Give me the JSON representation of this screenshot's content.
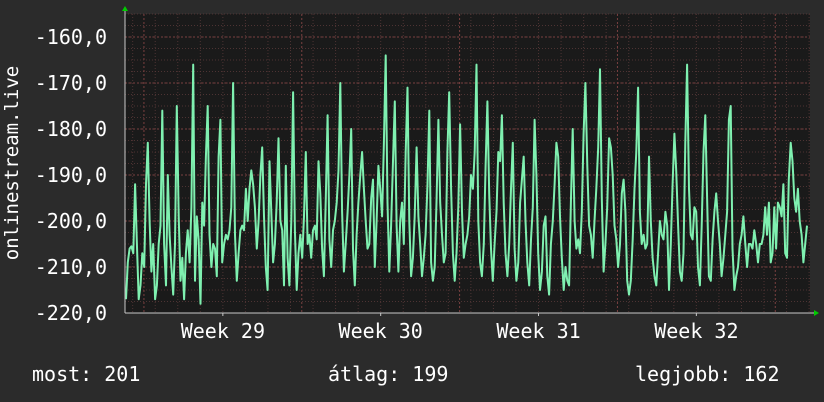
{
  "chart_data": {
    "type": "line",
    "ylabel": "onlinestream.live",
    "ylim": [
      -220,
      -155
    ],
    "y_ticks": [
      {
        "value": -160,
        "label": "-160,0"
      },
      {
        "value": -170,
        "label": "-170,0"
      },
      {
        "value": -180,
        "label": "-180,0"
      },
      {
        "value": -190,
        "label": "-190,0"
      },
      {
        "value": -200,
        "label": "-200,0"
      },
      {
        "value": -210,
        "label": "-210,0"
      },
      {
        "value": -220,
        "label": "-220,0"
      }
    ],
    "x_ticks": [
      {
        "value": 29,
        "label": "Week 29"
      },
      {
        "value": 30,
        "label": "Week 30"
      },
      {
        "value": 31,
        "label": "Week 31"
      },
      {
        "value": 32,
        "label": "Week 32"
      }
    ],
    "xlim": [
      28.38,
      32.72
    ],
    "grid": true,
    "colors": {
      "background": "#2b2b2b",
      "plot_area": "#1a1a1a",
      "grid": "#5a3a3a",
      "axis": "#c8c8c8",
      "line": "#7ff0b0",
      "arrow": "#00cc00",
      "text": "#ffffff"
    },
    "series": [
      {
        "values": [
          -217,
          -209,
          -206,
          -205.5,
          -207,
          -192,
          -205,
          -217,
          -214,
          -207,
          -210,
          -192,
          -183,
          -200,
          -211,
          -205,
          -217,
          -214,
          -205,
          -201,
          -176,
          -205,
          -214,
          -190,
          -203,
          -210,
          -216,
          -205,
          -175,
          -199,
          -213,
          -208,
          -217,
          -207,
          -202,
          -209,
          -197,
          -166,
          -213,
          -199,
          -204,
          -218,
          -196,
          -201,
          -186,
          -175,
          -203,
          -210,
          -205,
          -206,
          -212,
          -186,
          -178,
          -209,
          -205,
          -203,
          -204,
          -202,
          -197,
          -170,
          -203,
          -213,
          -207,
          -202,
          -201,
          -202,
          -193,
          -200,
          -193,
          -189,
          -192,
          -197,
          -206,
          -200,
          -190,
          -184,
          -199,
          -210,
          -215,
          -187,
          -198,
          -209,
          -205,
          -196,
          -182,
          -200,
          -202,
          -214,
          -188,
          -208,
          -214,
          -200,
          -172,
          -202,
          -215,
          -207,
          -203,
          -208,
          -199,
          -185,
          -205,
          -203,
          -208,
          -202,
          -201,
          -204,
          -187,
          -194,
          -206,
          -212,
          -195,
          -177,
          -204,
          -210,
          -202,
          -200,
          -196,
          -189,
          -170,
          -198,
          -211,
          -205,
          -198,
          -190,
          -180,
          -206,
          -214,
          -203,
          -196,
          -190,
          -185,
          -193,
          -200,
          -206,
          -205,
          -195,
          -191,
          -210,
          -200,
          -188,
          -193,
          -199,
          -183,
          -164,
          -196,
          -211,
          -201,
          -187,
          -174,
          -201,
          -211,
          -200,
          -196,
          -205,
          -185,
          -171,
          -200,
          -212,
          -208,
          -199,
          -184,
          -199,
          -205,
          -212,
          -208,
          -203,
          -192,
          -176,
          -209,
          -213,
          -210,
          -196,
          -178,
          -196,
          -203,
          -209,
          -207,
          -185,
          -172,
          -193,
          -207,
          -213,
          -207,
          -197,
          -179,
          -198,
          -208,
          -205,
          -203,
          -199,
          -190,
          -193,
          -185,
          -166,
          -200,
          -209,
          -212,
          -205,
          -188,
          -174,
          -194,
          -206,
          -213,
          -205,
          -198,
          -185,
          -187,
          -177,
          -196,
          -207,
          -212,
          -205,
          -193,
          -183,
          -206,
          -213,
          -209,
          -196,
          -191,
          -186,
          -200,
          -209,
          -214,
          -204,
          -197,
          -178,
          -190,
          -207,
          -215,
          -211,
          -201,
          -199,
          -212,
          -216,
          -205,
          -200,
          -192,
          -183,
          -186,
          -199,
          -208,
          -215,
          -210,
          -213,
          -214,
          -196,
          -180,
          -200,
          -206,
          -204,
          -207,
          -198,
          -181,
          -170,
          -188,
          -201,
          -203,
          -208,
          -200,
          -193,
          -184,
          -167,
          -195,
          -211,
          -205,
          -197,
          -182,
          -184,
          -190,
          -201,
          -204,
          -210,
          -205,
          -194,
          -191,
          -198,
          -213,
          -216,
          -213,
          -204,
          -193,
          -185,
          -171,
          -198,
          -205,
          -203,
          -206,
          -205,
          -186,
          -200,
          -208,
          -212,
          -214,
          -207,
          -200,
          -203,
          -204,
          -198,
          -201,
          -215,
          -205,
          -192,
          -181,
          -189,
          -201,
          -211,
          -213,
          -207,
          -183,
          -166,
          -193,
          -203,
          -204,
          -197,
          -198,
          -210,
          -214,
          -201,
          -185,
          -177,
          -195,
          -212,
          -213,
          -204,
          -198,
          -194,
          -200,
          -205,
          -212,
          -208,
          -203,
          -198,
          -178,
          -175,
          -206,
          -215,
          -212,
          -210,
          -205,
          -203,
          -199,
          -205,
          -210,
          -205,
          -205,
          -206,
          -202,
          -205,
          -209,
          -205,
          -205,
          -203,
          -197,
          -203,
          -196,
          -209,
          -207,
          -197,
          -206,
          -196,
          -197,
          -199,
          -192,
          -207,
          -208,
          -191,
          -183,
          -187,
          -195,
          -198,
          -193,
          -200,
          -203,
          -209,
          -205,
          -201
        ]
      }
    ]
  },
  "stats": {
    "current": "most: 201",
    "average": "átlag: 199",
    "best": "legjobb: 162"
  }
}
